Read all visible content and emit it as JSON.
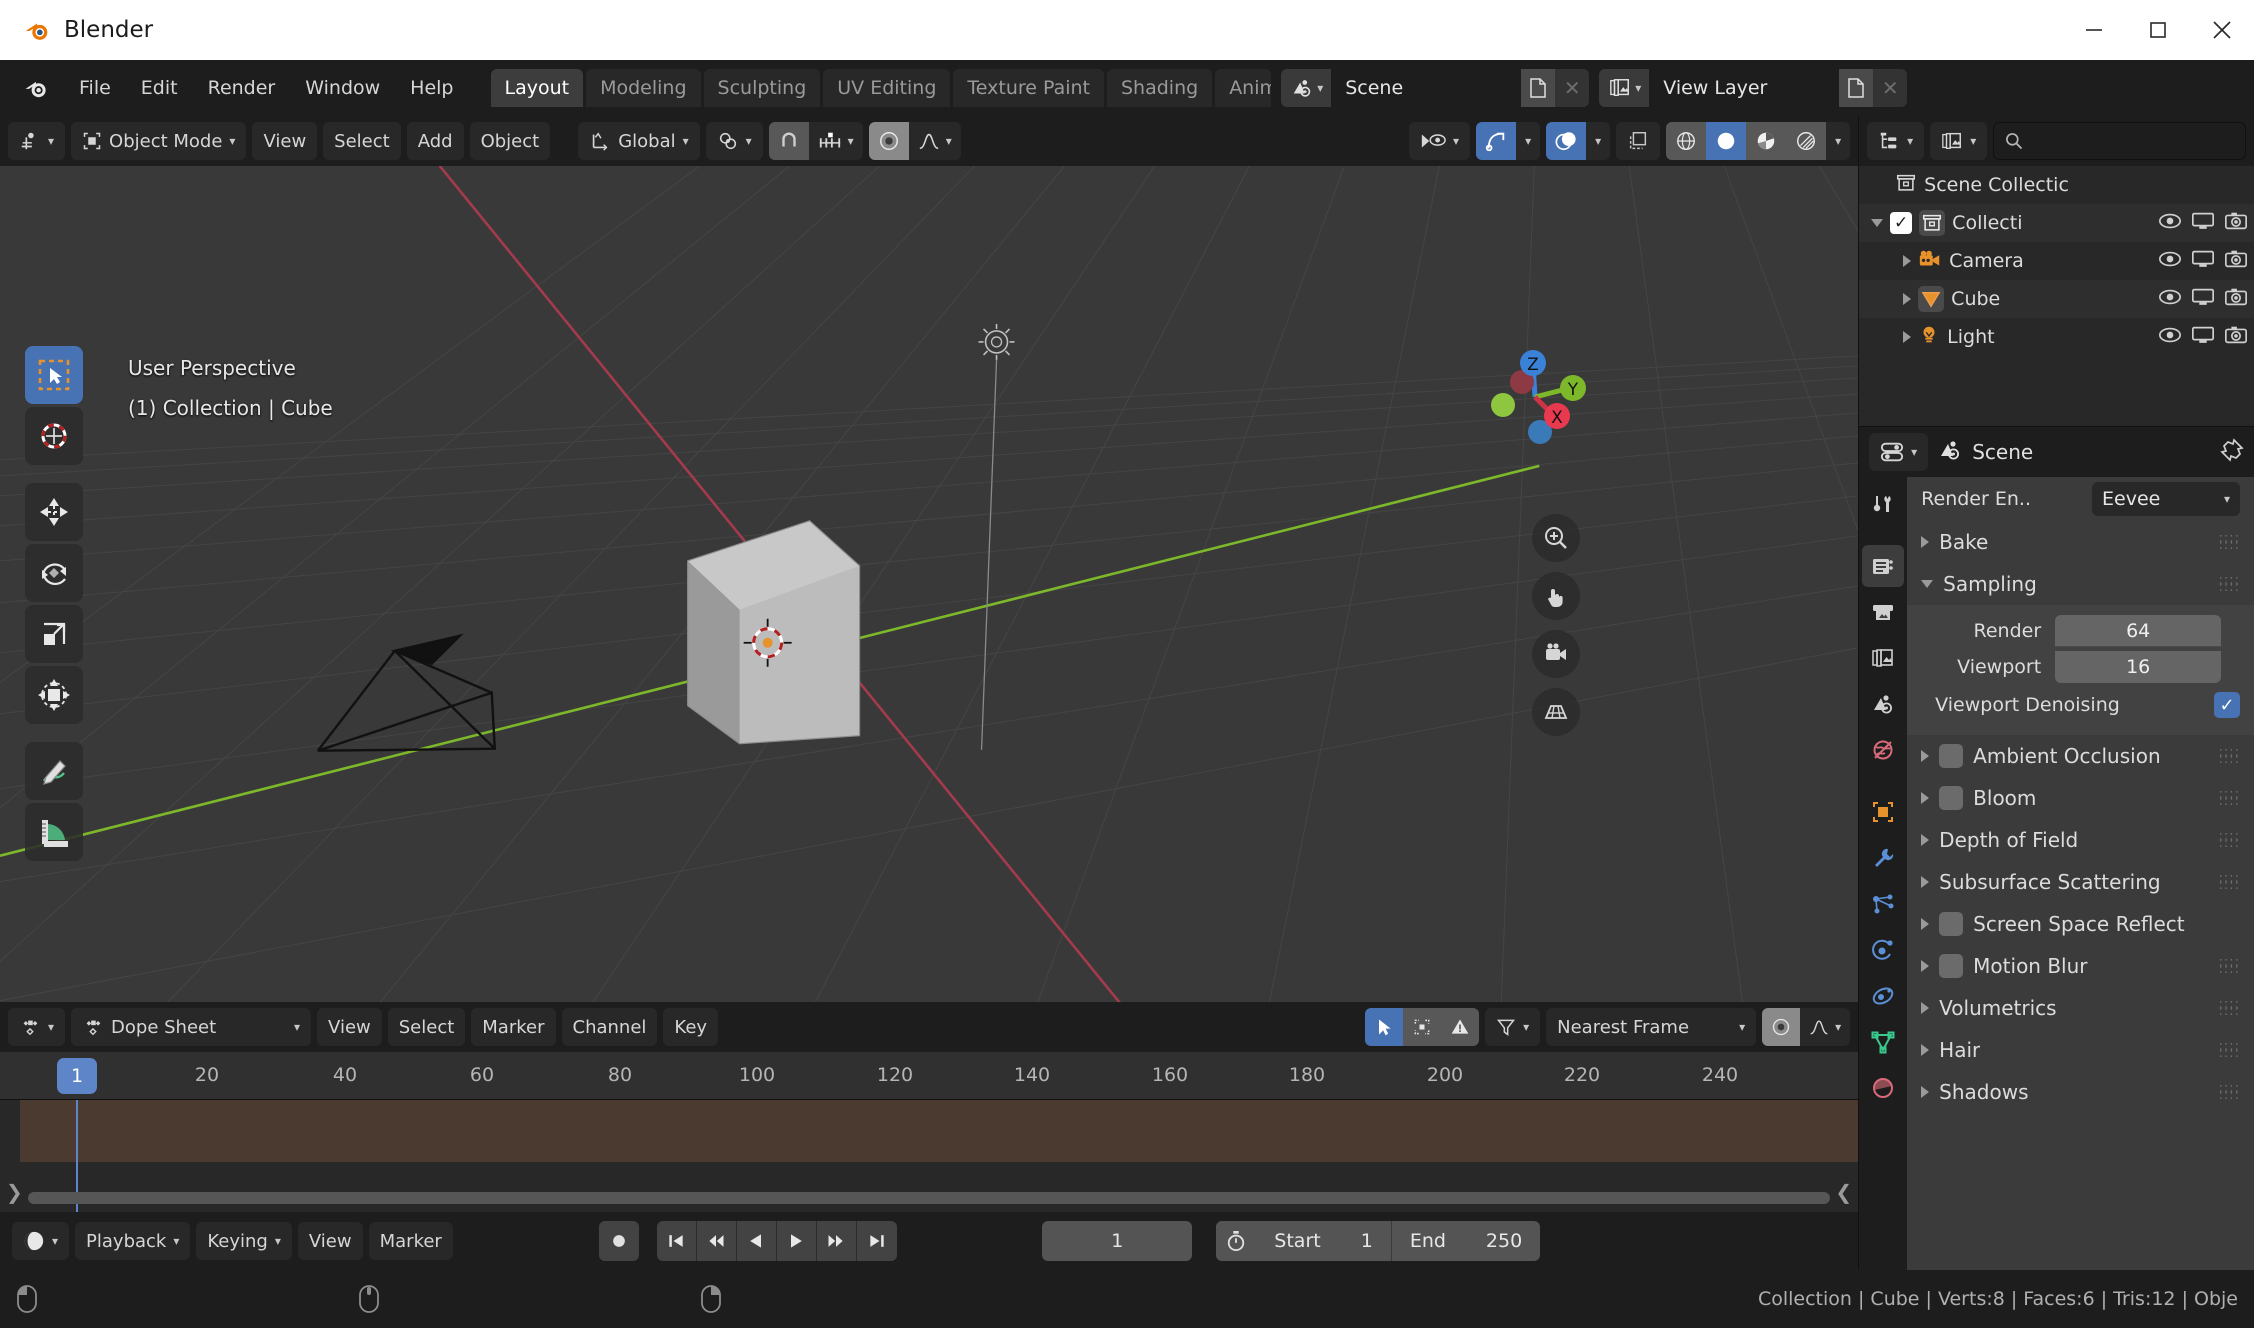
{
  "window": {
    "title": "Blender",
    "controls": [
      "minimize",
      "maximize",
      "close"
    ]
  },
  "topbar": {
    "menus": [
      "File",
      "Edit",
      "Render",
      "Window",
      "Help"
    ],
    "workspaces": [
      {
        "label": "Layout",
        "active": true
      },
      {
        "label": "Modeling",
        "active": false
      },
      {
        "label": "Sculpting",
        "active": false
      },
      {
        "label": "UV Editing",
        "active": false
      },
      {
        "label": "Texture Paint",
        "active": false
      },
      {
        "label": "Shading",
        "active": false
      },
      {
        "label": "Anim",
        "active": false
      }
    ],
    "scene": {
      "name": "Scene",
      "icon": "scene-icon"
    },
    "view_layer": {
      "name": "View Layer",
      "icon": "view-layer-icon"
    }
  },
  "viewport_header": {
    "editor_type": "editor-type-3dview",
    "mode": "Object Mode",
    "menus": [
      "View",
      "Select",
      "Add",
      "Object"
    ],
    "transform_orientation": "Global",
    "snap_enabled": true,
    "proportional_edit_enabled": true,
    "gizmo_enabled": true,
    "overlays_enabled": true,
    "xray_enabled": false,
    "shading": [
      "wireframe",
      "solid",
      "material-preview",
      "rendered"
    ],
    "shading_active": "solid"
  },
  "viewport": {
    "perspective_label": "User Perspective",
    "collection_label": "(1) Collection | Cube",
    "gizmo_axes": [
      "Z",
      "Y",
      "X"
    ],
    "colors": {
      "x_axis": "#cc3344",
      "y_axis": "#7db82a",
      "z_axis": "#3a82d8",
      "background": "#393939",
      "grid": "#4a4a4a",
      "cube": "#b8b8b8",
      "accent": "#4772b3",
      "orange": "#e8922c"
    },
    "tools": [
      {
        "name": "tweak-tool",
        "active": true
      },
      {
        "name": "cursor-tool",
        "active": false
      },
      {
        "name": "move-tool",
        "active": false
      },
      {
        "name": "rotate-tool",
        "active": false
      },
      {
        "name": "scale-tool",
        "active": false
      },
      {
        "name": "transform-tool",
        "active": false
      },
      {
        "name": "annotate-tool",
        "active": false
      },
      {
        "name": "measure-tool",
        "active": false
      }
    ],
    "nav_buttons": [
      "zoom-icon",
      "pan-icon",
      "camera-view-icon",
      "toggle-perspective-icon"
    ]
  },
  "dopesheet": {
    "editor_type": "editor-type-dopesheet",
    "mode": "Dope Sheet",
    "menus": [
      "View",
      "Select",
      "Marker",
      "Channel",
      "Key"
    ],
    "snap_mode": "Nearest Frame",
    "ruler_ticks": [
      20,
      40,
      60,
      80,
      100,
      120,
      140,
      160,
      180,
      200,
      220,
      240
    ],
    "current_frame": 1,
    "proportional_enabled": true
  },
  "playback": {
    "editor_type": "editor-type-timeline",
    "menus": [
      "Playback",
      "Keying",
      "View",
      "Marker"
    ],
    "transport": [
      "jump-start-icon",
      "prev-keyframe-icon",
      "play-reverse-icon",
      "play-icon",
      "next-keyframe-icon",
      "jump-end-icon"
    ],
    "record_icon": "record-icon",
    "current_frame": "1",
    "auto_key_icon": "auto-keying-icon",
    "start_label": "Start",
    "start_value": "1",
    "end_label": "End",
    "end_value": "250"
  },
  "outliner": {
    "display_mode_icon": "outliner-display-mode-icon",
    "filter_icon": "outliner-filter-icon",
    "search_placeholder": "",
    "rows": [
      {
        "label": "Scene Collectic",
        "icon": "collection-icon",
        "depth": 0,
        "expander": "none",
        "checkbox": false,
        "visibility": false,
        "selected": false
      },
      {
        "label": "Collecti",
        "icon": "collection-icon",
        "depth": 1,
        "expander": "down",
        "checkbox": true,
        "visibility": true,
        "selected": true
      },
      {
        "label": "Camera",
        "icon": "camera-data-icon",
        "depth": 2,
        "expander": "right",
        "checkbox": false,
        "visibility": true,
        "selected": false
      },
      {
        "label": "Cube",
        "icon": "mesh-data-icon",
        "depth": 2,
        "expander": "right",
        "checkbox": false,
        "visibility": true,
        "selected": true
      },
      {
        "label": "Light",
        "icon": "light-data-icon",
        "depth": 2,
        "expander": "right",
        "checkbox": false,
        "visibility": true,
        "selected": false
      }
    ],
    "visibility_icons": [
      "eye-icon",
      "monitor-icon",
      "camera-render-icon"
    ]
  },
  "properties": {
    "editor_type_icon": "editor-type-properties-icon",
    "breadcrumb": "Scene",
    "breadcrumb_icon": "scene-icon",
    "pin_icon": "pin-icon",
    "tabs": [
      {
        "name": "tool-tab",
        "icon": "tool-icon",
        "selected": false,
        "color": "#d0d0d0"
      },
      {
        "name": "render-tab",
        "icon": "render-camera-icon",
        "selected": true,
        "color": "#d0d0d0"
      },
      {
        "name": "output-tab",
        "icon": "printer-icon",
        "selected": false,
        "color": "#d0d0d0"
      },
      {
        "name": "view-layer-tab",
        "icon": "images-icon",
        "selected": false,
        "color": "#d0d0d0"
      },
      {
        "name": "scene-tab",
        "icon": "scene-icon",
        "selected": false,
        "color": "#d0d0d0"
      },
      {
        "name": "world-tab",
        "icon": "world-icon",
        "selected": false,
        "color": "#d96a7a"
      },
      {
        "name": "object-tab",
        "icon": "object-square-icon",
        "selected": false,
        "color": "#e8922c"
      },
      {
        "name": "modifiers-tab",
        "icon": "wrench-icon",
        "selected": false,
        "color": "#5b8fd6"
      },
      {
        "name": "particles-tab",
        "icon": "particles-icon",
        "selected": false,
        "color": "#5b8fd6"
      },
      {
        "name": "physics-tab",
        "icon": "physics-icon",
        "selected": false,
        "color": "#5b8fd6"
      },
      {
        "name": "constraints-tab",
        "icon": "constraints-icon",
        "selected": false,
        "color": "#5b8fd6"
      },
      {
        "name": "data-tab",
        "icon": "mesh-triangle-icon",
        "selected": false,
        "color": "#39c98b"
      },
      {
        "name": "material-tab",
        "icon": "material-sphere-icon",
        "selected": false,
        "color": "#d96a7a"
      }
    ],
    "render_engine_label": "Render En..",
    "render_engine_value": "Eevee",
    "sections": [
      {
        "title": "Bake",
        "expanded": false,
        "checkbox": null
      },
      {
        "title": "Sampling",
        "expanded": true,
        "checkbox": null
      },
      {
        "title": "Ambient Occlusion",
        "expanded": false,
        "checkbox": false
      },
      {
        "title": "Bloom",
        "expanded": false,
        "checkbox": false
      },
      {
        "title": "Depth of Field",
        "expanded": false,
        "checkbox": null
      },
      {
        "title": "Subsurface Scattering",
        "expanded": false,
        "checkbox": null
      },
      {
        "title": "Screen Space Reflect",
        "expanded": false,
        "checkbox": false
      },
      {
        "title": "Motion Blur",
        "expanded": false,
        "checkbox": false
      },
      {
        "title": "Volumetrics",
        "expanded": false,
        "checkbox": null
      },
      {
        "title": "Hair",
        "expanded": false,
        "checkbox": null
      },
      {
        "title": "Shadows",
        "expanded": false,
        "checkbox": null
      }
    ],
    "sampling": {
      "render_label": "Render",
      "render_value": "64",
      "viewport_label": "Viewport",
      "viewport_value": "16",
      "denoising_label": "Viewport Denoising",
      "denoising_checked": true
    }
  },
  "statusbar": {
    "info": "Collection | Cube | Verts:8 | Faces:6 | Tris:12 | Obje"
  }
}
